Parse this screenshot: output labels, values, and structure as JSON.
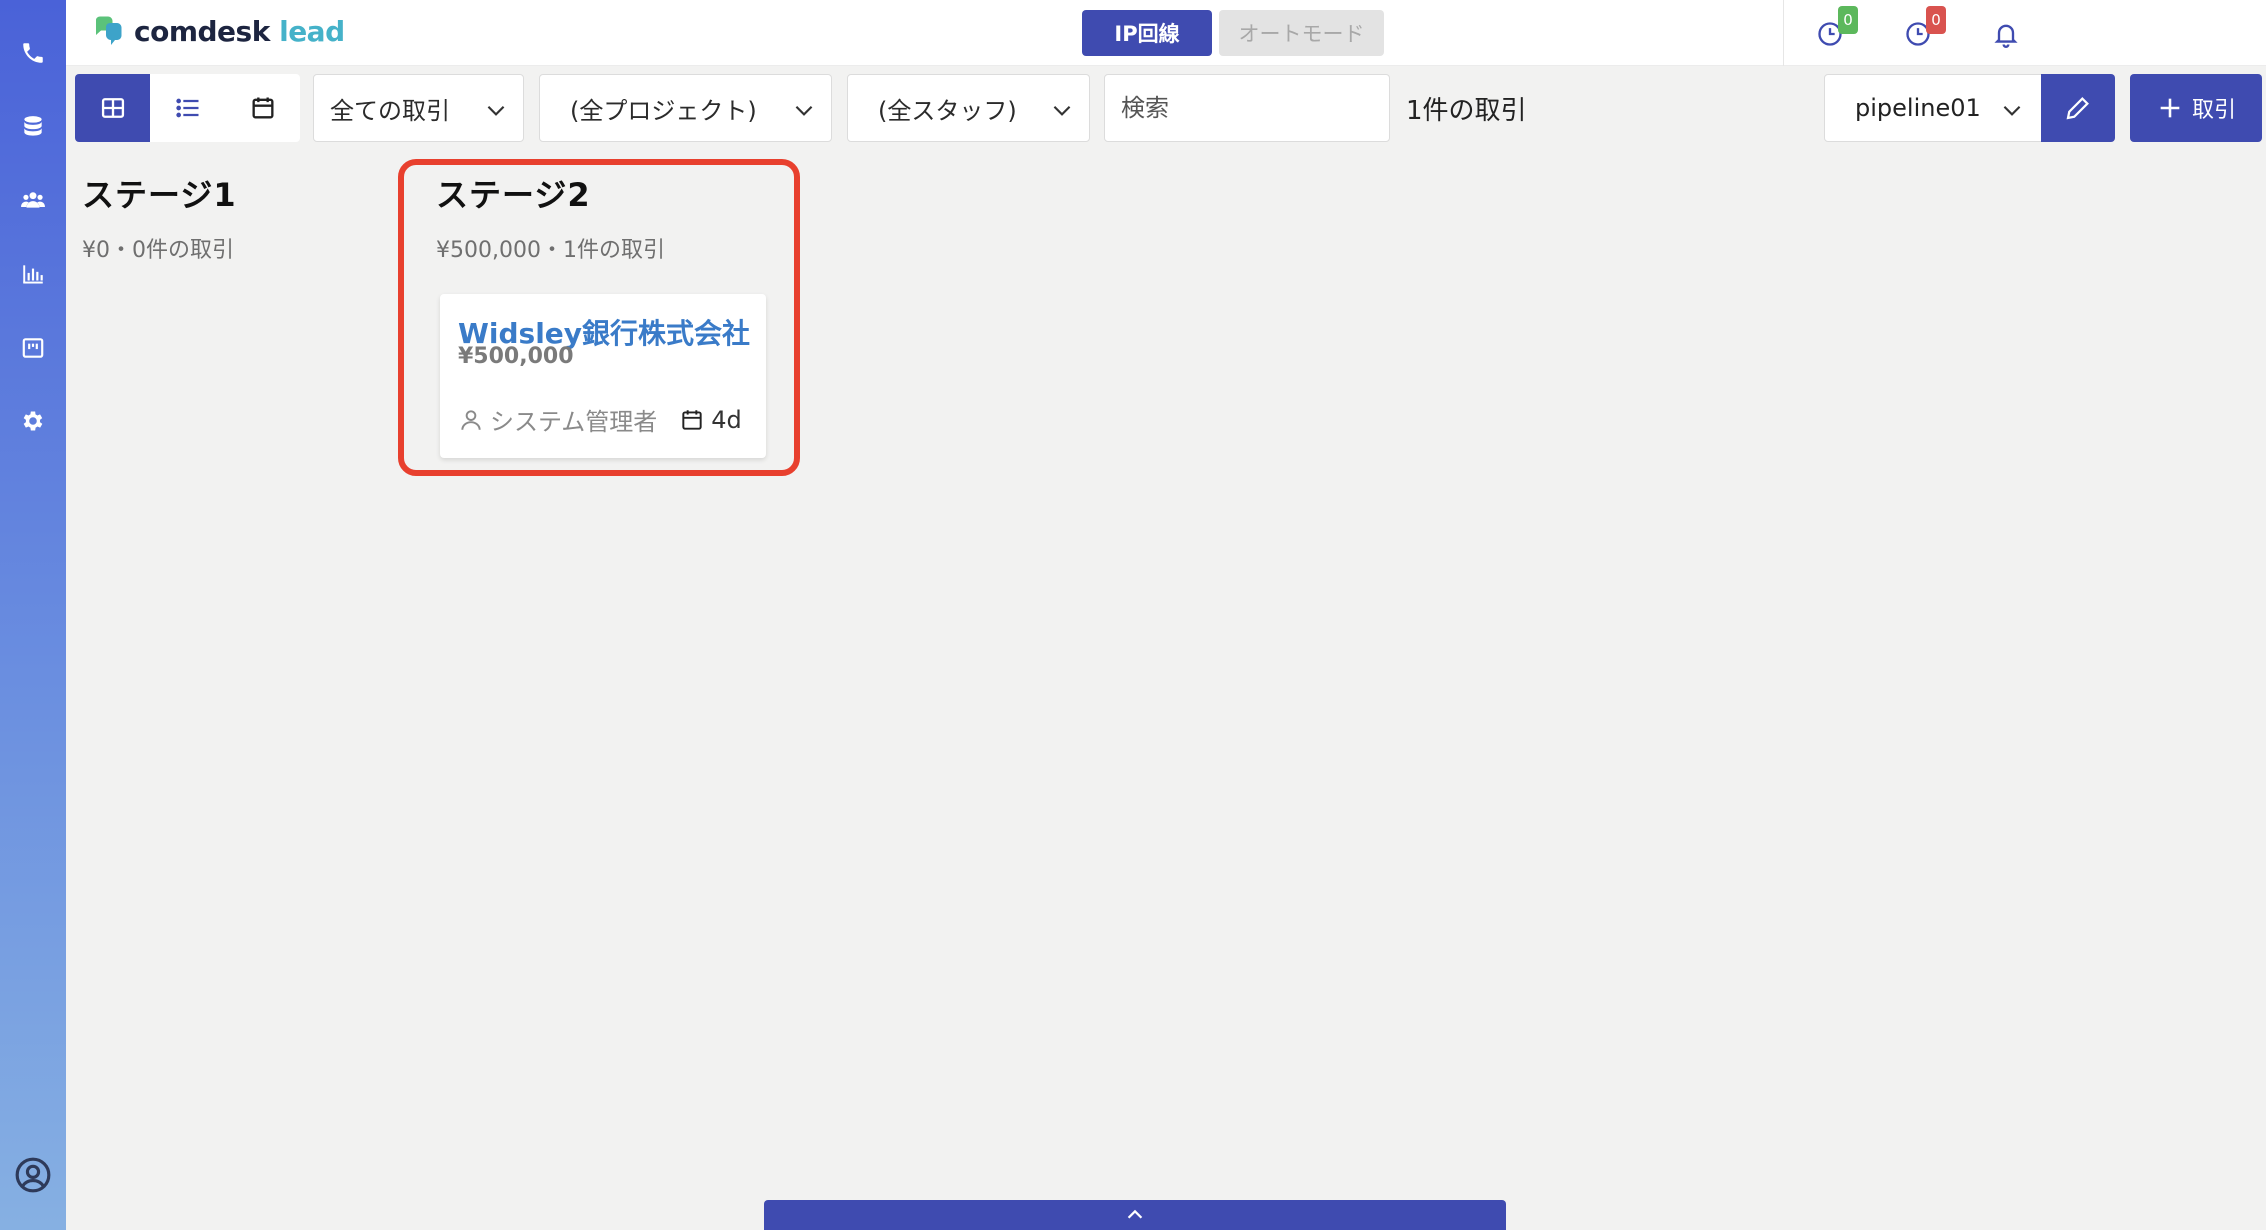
{
  "app": {
    "logo_name": "comdesk",
    "logo_suffix": "lead"
  },
  "sidebar": {
    "items": [
      {
        "icon": "phone-icon"
      },
      {
        "icon": "database-icon"
      },
      {
        "icon": "users-icon"
      },
      {
        "icon": "chart-icon"
      },
      {
        "icon": "board-icon"
      },
      {
        "icon": "gear-icon"
      }
    ],
    "bottom_icon": "user-circle-icon"
  },
  "header": {
    "mode_ip": "IP回線",
    "mode_auto": "オートモード",
    "badge_green": "0",
    "badge_red": "0"
  },
  "toolbar": {
    "filter_deals": "全ての取引",
    "filter_projects": "(全プロジェクト)",
    "filter_staff": "(全スタッフ)",
    "search_placeholder": "検索",
    "deal_count": "1件の取引",
    "pipeline": "pipeline01",
    "add_label": "取引"
  },
  "board": {
    "stages": [
      {
        "title": "ステージ1",
        "summary": "¥0・0件の取引"
      },
      {
        "title": "ステージ2",
        "summary": "¥500,000・1件の取引"
      }
    ],
    "deal": {
      "name": "Widsley銀行株式会社",
      "amount": "¥500,000",
      "owner": "システム管理者",
      "age": "4d"
    }
  },
  "colors": {
    "primary": "#3f4bb0",
    "highlight": "#e8402e",
    "deal_link": "#3a7bc8"
  }
}
